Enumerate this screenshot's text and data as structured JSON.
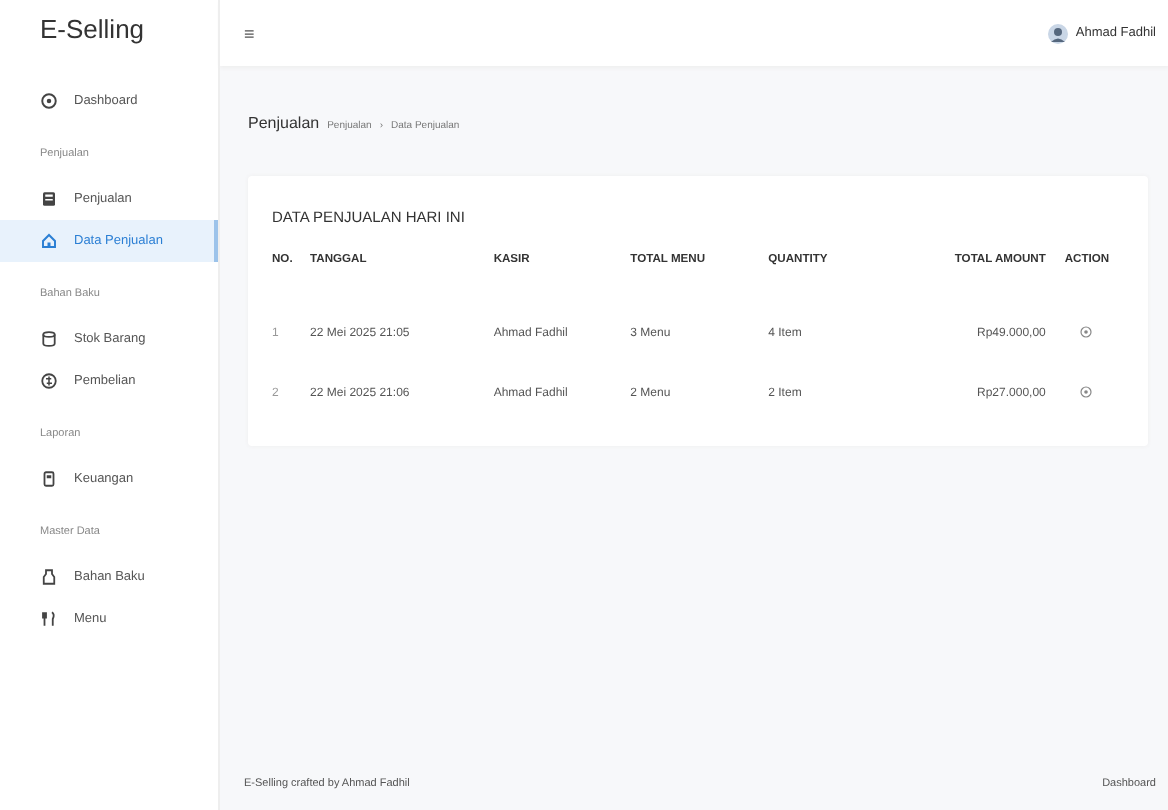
{
  "brand": "E-Selling",
  "sidebar": [
    {
      "kind": "item",
      "label": "Dashboard",
      "selected": false
    },
    {
      "kind": "section",
      "label": "Penjualan"
    },
    {
      "kind": "item",
      "label": "Penjualan",
      "selected": false
    },
    {
      "kind": "item",
      "label": "Data Penjualan",
      "selected": true
    },
    {
      "kind": "section",
      "label": "Bahan Baku"
    },
    {
      "kind": "item",
      "label": "Stok Barang",
      "selected": false
    },
    {
      "kind": "item",
      "label": "Pembelian",
      "selected": false
    },
    {
      "kind": "section",
      "label": "Laporan"
    },
    {
      "kind": "item",
      "label": "Keuangan",
      "selected": false
    },
    {
      "kind": "section",
      "label": "Master Data"
    },
    {
      "kind": "item",
      "label": "Bahan Baku",
      "selected": false
    },
    {
      "kind": "item",
      "label": "Menu",
      "selected": false
    }
  ],
  "topbar": {
    "menu_glyph": "≡",
    "user": "Ahmad Fadhil"
  },
  "breadcrumb": {
    "title": "Penjualan",
    "path": [
      "Penjualan",
      "Data Penjualan"
    ],
    "separator": "›"
  },
  "card": {
    "title": "DATA PENJUALAN HARI INI",
    "columns": [
      "NO.",
      "TANGGAL",
      "KASIR",
      "TOTAL MENU",
      "QUANTITY",
      "TOTAL AMOUNT",
      "ACTION"
    ],
    "rows": [
      [
        "1",
        "22 Mei 2025 21:05",
        "Ahmad Fadhil",
        "3 Menu",
        "4 Item",
        "Rp49.000,00"
      ],
      [
        "2",
        "22 Mei 2025 21:06",
        "Ahmad Fadhil",
        "2 Menu",
        "2 Item",
        "Rp27.000,00"
      ]
    ]
  },
  "footer": {
    "credit": "E-Selling crafted by Ahmad Fadhil",
    "link": "Dashboard"
  }
}
